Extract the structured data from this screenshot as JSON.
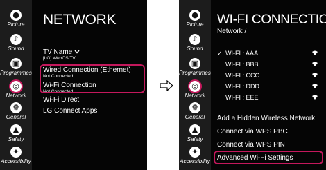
{
  "sidebar": {
    "items": [
      {
        "label": "Picture",
        "icon": "picture-icon",
        "glyph": "●"
      },
      {
        "label": "Sound",
        "icon": "sound-icon",
        "glyph": "♪"
      },
      {
        "label": "Programmes",
        "icon": "programmes-icon",
        "glyph": "▣"
      },
      {
        "label": "Network",
        "icon": "network-icon",
        "glyph": "◎",
        "active": true
      },
      {
        "label": "General",
        "icon": "general-icon",
        "glyph": "⚙"
      },
      {
        "label": "Safety",
        "icon": "safety-icon",
        "glyph": "▲"
      },
      {
        "label": "Accessibility",
        "icon": "accessibility-icon",
        "glyph": "✦"
      }
    ]
  },
  "network_screen": {
    "title": "NETWORK",
    "tv_name_label": "TV Name",
    "tv_name_value": "[LG] WebOS TV",
    "wired_label": "Wired Connection (Ethernet)",
    "wired_status": "Not Connected",
    "wifi_label": "Wi-Fi Connection",
    "wifi_status": "Not Connected",
    "wifi_direct": "Wi-Fi Direct",
    "lg_connect_apps": "LG Connect Apps"
  },
  "wifi_screen": {
    "title": "WI-FI CONNECTION",
    "breadcrumb": "Network /",
    "networks": [
      {
        "name": "WI-FI : AAA",
        "selected": true
      },
      {
        "name": "WI-FI : BBB",
        "selected": false
      },
      {
        "name": "WI-FI : CCC",
        "selected": false
      },
      {
        "name": "WI-FI : DDD",
        "selected": false
      },
      {
        "name": "WI-FI : EEE",
        "selected": false
      }
    ],
    "check_mark": "✓",
    "add_hidden": "Add a Hidden Wireless Network",
    "wps_pbc": "Connect via WPS PBC",
    "wps_pin": "Connect via WPS PIN",
    "advanced": "Advanced Wi-Fi Settings"
  },
  "colors": {
    "highlight": "#c4185c",
    "background": "#050505",
    "sidebar": "#1c1c1c"
  }
}
